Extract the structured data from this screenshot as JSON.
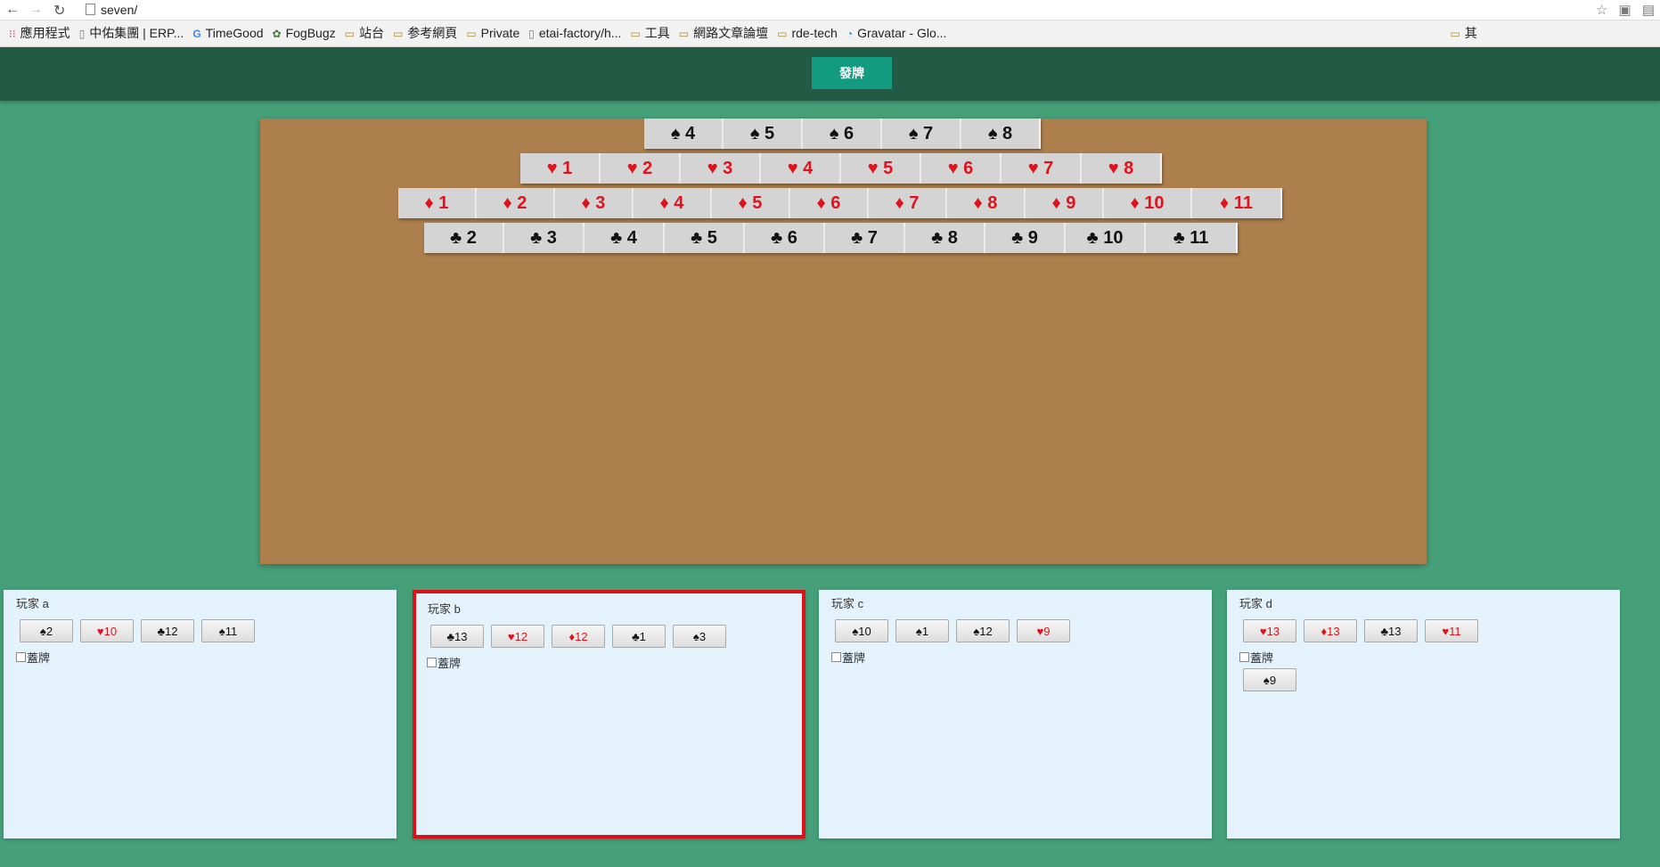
{
  "browser": {
    "url": "seven/",
    "bookmarks": [
      {
        "icon": "apps-icon",
        "label": "應用程式"
      },
      {
        "icon": "page-icon",
        "label": "中佑集團 | ERP..."
      },
      {
        "icon": "google-icon",
        "label": "TimeGood"
      },
      {
        "icon": "fogbugz-icon",
        "label": "FogBugz"
      },
      {
        "icon": "folder-icon",
        "label": "站台"
      },
      {
        "icon": "folder-icon",
        "label": "参考網頁"
      },
      {
        "icon": "folder-icon",
        "label": "Private"
      },
      {
        "icon": "page-icon",
        "label": "etai-factory/h..."
      },
      {
        "icon": "folder-icon",
        "label": "工具"
      },
      {
        "icon": "folder-icon",
        "label": "網路文章論壇"
      },
      {
        "icon": "folder-icon",
        "label": "rde-tech"
      },
      {
        "icon": "gravatar-icon",
        "label": "Gravatar - Glo..."
      },
      {
        "icon": "folder-icon",
        "label": "其"
      }
    ]
  },
  "header": {
    "deal_label": "發牌"
  },
  "board": {
    "rows": [
      {
        "suit": "♠",
        "color": "black",
        "cards": [
          "♠ 4",
          "♠ 5",
          "♠ 6",
          "♠ 7",
          "♠ 8"
        ]
      },
      {
        "suit": "♥",
        "color": "red",
        "cards": [
          "♥ 1",
          "♥ 2",
          "♥ 3",
          "♥ 4",
          "♥ 5",
          "♥ 6",
          "♥ 7",
          "♥ 8"
        ]
      },
      {
        "suit": "♦",
        "color": "red",
        "cards": [
          "♦ 1",
          "♦ 2",
          "♦ 3",
          "♦ 4",
          "♦ 5",
          "♦ 6",
          "♦ 7",
          "♦ 8",
          "♦ 9",
          "♦ 10",
          "♦ 11"
        ]
      },
      {
        "suit": "♣",
        "color": "black",
        "cards": [
          "♣ 2",
          "♣ 3",
          "♣ 4",
          "♣ 5",
          "♣ 6",
          "♣ 7",
          "♣ 8",
          "♣ 9",
          "♣ 10",
          "♣ 11"
        ]
      }
    ]
  },
  "players": [
    {
      "name": "玩家 a",
      "active": false,
      "cover_label": "蓋牌",
      "hand": [
        {
          "text": "♠2",
          "color": "black"
        },
        {
          "text": "♥10",
          "color": "red"
        },
        {
          "text": "♣12",
          "color": "black"
        },
        {
          "text": "♠11",
          "color": "black"
        }
      ],
      "covered": []
    },
    {
      "name": "玩家 b",
      "active": true,
      "cover_label": "蓋牌",
      "hand": [
        {
          "text": "♣13",
          "color": "black"
        },
        {
          "text": "♥12",
          "color": "red"
        },
        {
          "text": "♦12",
          "color": "red"
        },
        {
          "text": "♣1",
          "color": "black"
        },
        {
          "text": "♠3",
          "color": "black"
        }
      ],
      "covered": []
    },
    {
      "name": "玩家 c",
      "active": false,
      "cover_label": "蓋牌",
      "hand": [
        {
          "text": "♠10",
          "color": "black"
        },
        {
          "text": "♠1",
          "color": "black"
        },
        {
          "text": "♠12",
          "color": "black"
        },
        {
          "text": "♥9",
          "color": "red"
        }
      ],
      "covered": []
    },
    {
      "name": "玩家 d",
      "active": false,
      "cover_label": "蓋牌",
      "hand": [
        {
          "text": "♥13",
          "color": "red"
        },
        {
          "text": "♦13",
          "color": "red"
        },
        {
          "text": "♣13",
          "color": "black"
        },
        {
          "text": "♥11",
          "color": "red"
        }
      ],
      "covered": [
        {
          "text": "♠9",
          "color": "black"
        }
      ]
    }
  ],
  "colors": {
    "background": "#45a079",
    "header": "#225a45",
    "deal_button": "#129b80",
    "board": "#ad7f4c",
    "panel": "#e4f2fc",
    "active_border": "#e01018",
    "red_suit": "#e0121c"
  }
}
